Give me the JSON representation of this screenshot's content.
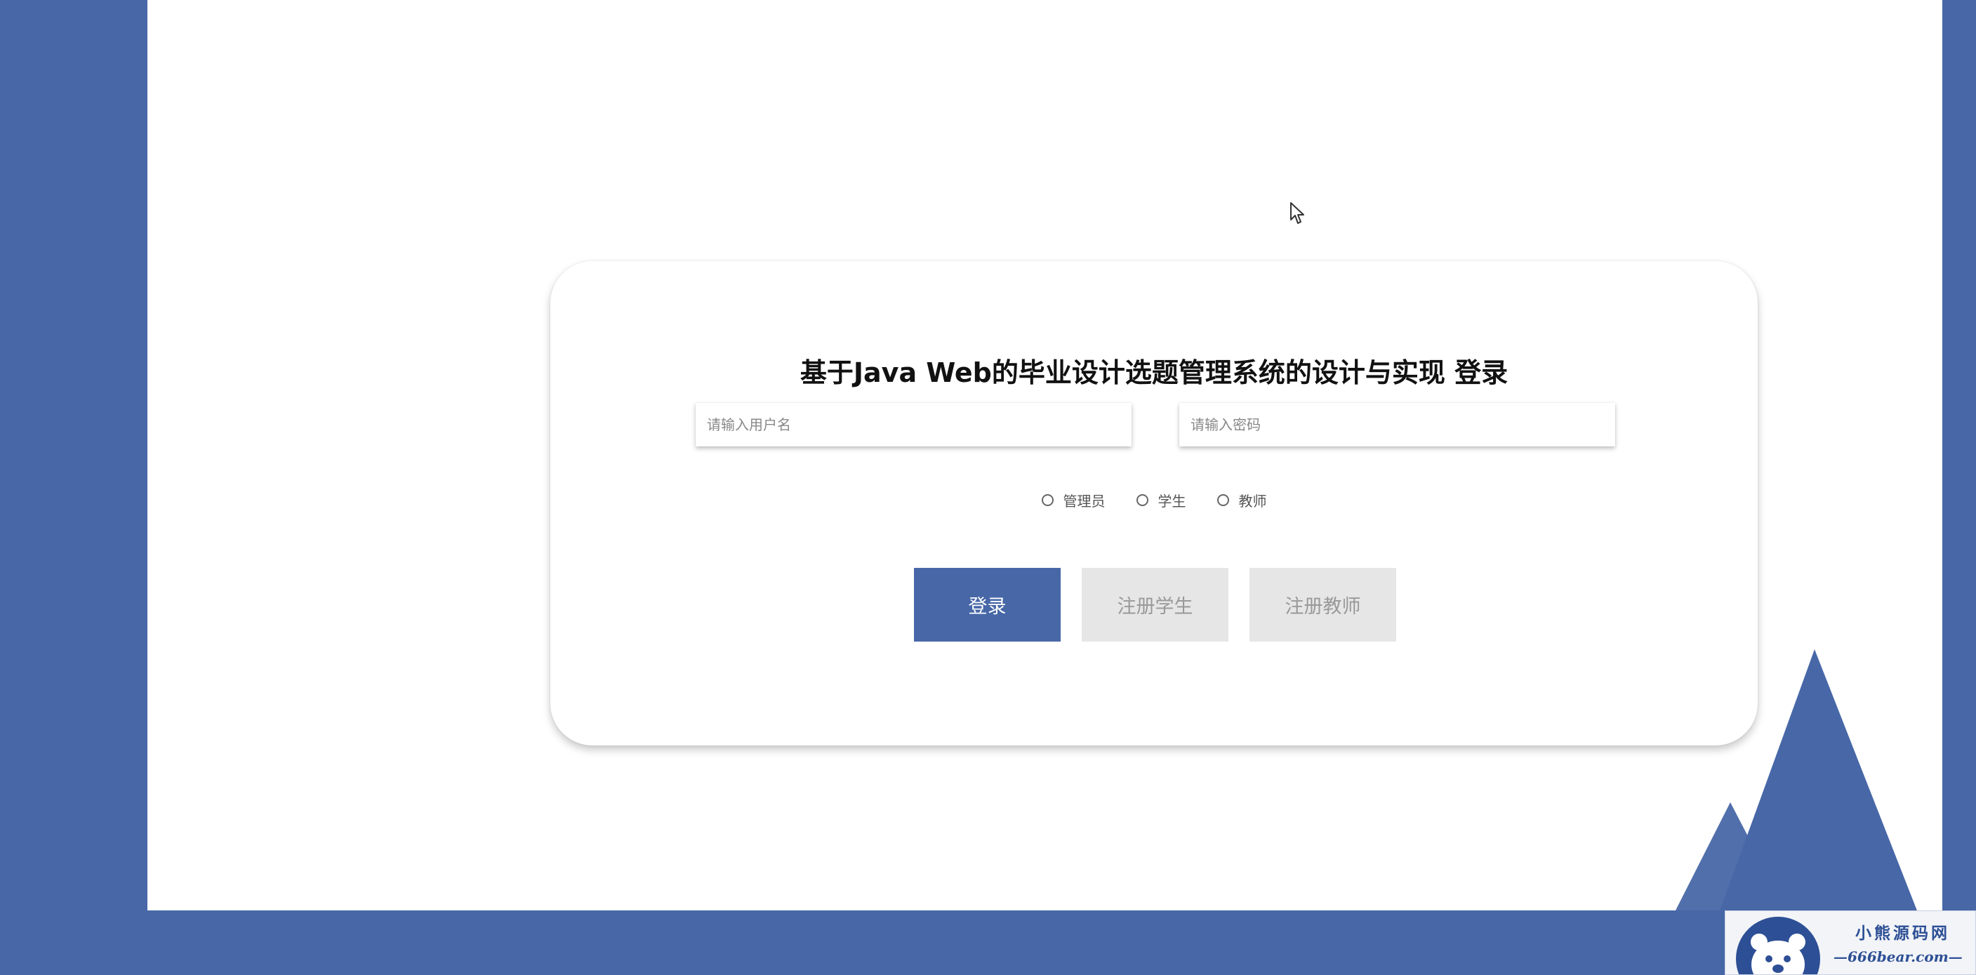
{
  "page": {
    "title": "基于Java Web的毕业设计选题管理系统的设计与实现 登录"
  },
  "form": {
    "username_placeholder": "请输入用户名",
    "password_placeholder": "请输入密码",
    "roles": [
      "管理员",
      "学生",
      "教师"
    ]
  },
  "buttons": {
    "login": "登录",
    "register_student": "注册学生",
    "register_teacher": "注册教师"
  },
  "watermark": {
    "cn": "小熊源码网",
    "url": "—666bear.com—"
  },
  "colors": {
    "primary": "#4767a7",
    "secondary_button": "#e6e6e6",
    "secondary_text": "#999999",
    "background": "#ffffff"
  }
}
